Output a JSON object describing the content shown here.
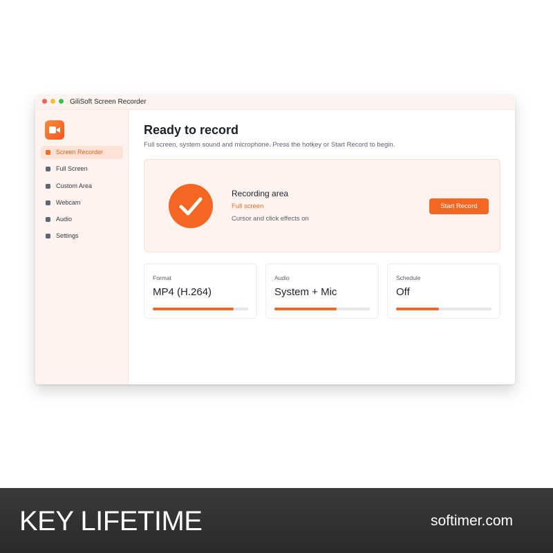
{
  "window": {
    "title": "GiliSoft Screen Recorder"
  },
  "sidebar": {
    "logo_icon": "video-camera-icon",
    "items": [
      {
        "label": "Screen Recorder",
        "active": true
      },
      {
        "label": "Full Screen",
        "active": false
      },
      {
        "label": "Custom Area",
        "active": false
      },
      {
        "label": "Webcam",
        "active": false
      },
      {
        "label": "Audio",
        "active": false
      },
      {
        "label": "Settings",
        "active": false
      }
    ]
  },
  "main": {
    "title": "Ready to record",
    "subtitle": "Full screen, system sound and microphone. Press the hotkey or Start Record to begin.",
    "hero": {
      "status_icon": "checkmark-icon",
      "heading": "Recording area",
      "mode": "Full screen",
      "note": "Cursor and click effects on",
      "button_label": "Start Record"
    },
    "cards": [
      {
        "label": "Format",
        "value": "MP4 (H.264)",
        "level": 0.85
      },
      {
        "label": "Audio",
        "value": "System + Mic",
        "level": 0.65
      },
      {
        "label": "Schedule",
        "value": "Off",
        "level": 0.45
      }
    ]
  },
  "banner": {
    "left_text": "KEY LIFETIME",
    "right_text": "softimer.com"
  },
  "colors": {
    "accent": "#f36722",
    "sidebar_bg": "#fef3ee",
    "banner_bg": "#2f2f2f"
  }
}
